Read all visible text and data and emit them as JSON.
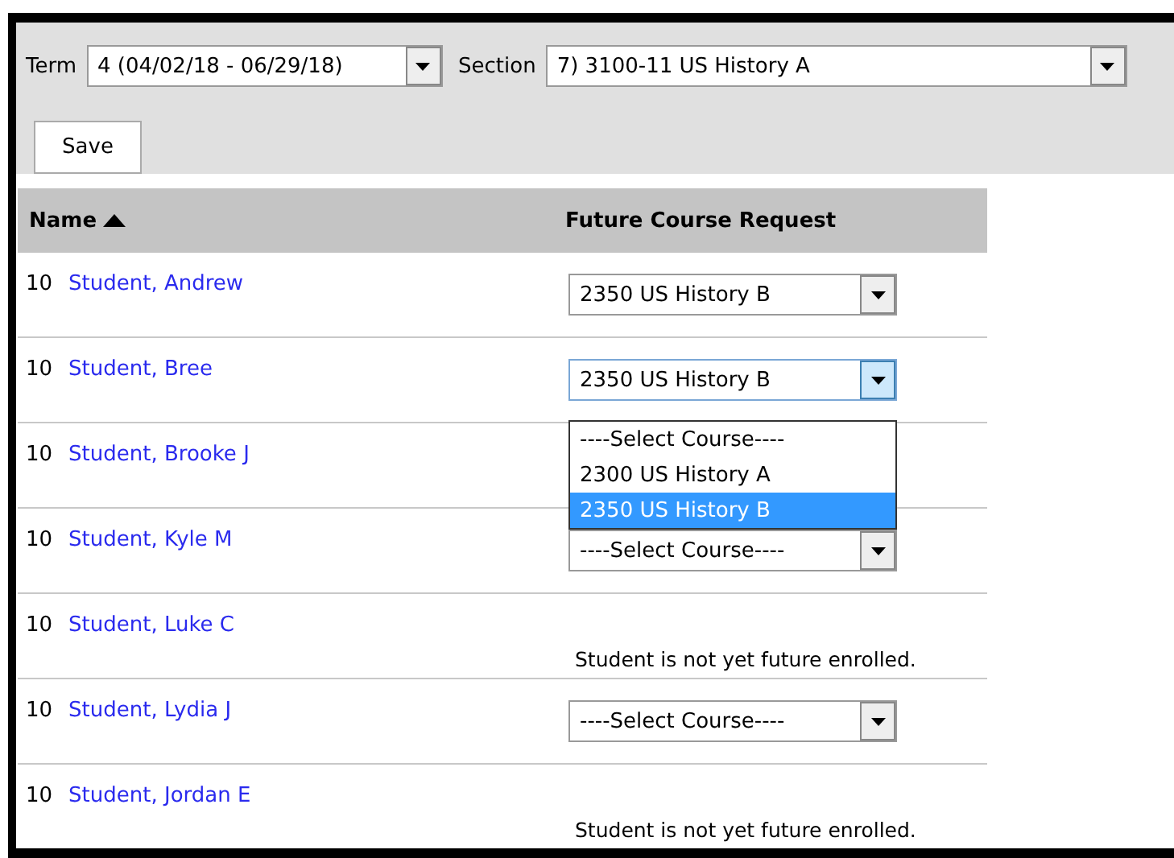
{
  "filters": {
    "term": {
      "label": "Term",
      "value": "4 (04/02/18 - 06/29/18)"
    },
    "section": {
      "label": "Section",
      "value": "7) 3100-11 US History A"
    }
  },
  "save_button": "Save",
  "table": {
    "columns": [
      {
        "label": "Name",
        "sorted": true
      },
      {
        "label": "Future Course Request",
        "sorted": false
      }
    ],
    "rows": [
      {
        "grade": "10",
        "name": "Student, Andrew",
        "request": {
          "kind": "select",
          "value": "2350 US History B",
          "expanded": false
        }
      },
      {
        "grade": "10",
        "name": "Student, Bree",
        "request": {
          "kind": "select",
          "value": "2350 US History B",
          "expanded": true,
          "options": [
            {
              "label": "----Select Course----",
              "selected": false
            },
            {
              "label": "2300 US History A",
              "selected": false
            },
            {
              "label": "2350 US History B",
              "selected": true
            }
          ]
        }
      },
      {
        "grade": "10",
        "name": "Student, Brooke J",
        "request": {
          "kind": "hidden"
        }
      },
      {
        "grade": "10",
        "name": "Student, Kyle M",
        "request": {
          "kind": "select",
          "value": "----Select Course----",
          "expanded": false
        }
      },
      {
        "grade": "10",
        "name": "Student, Luke C",
        "request": {
          "kind": "message",
          "text": "Student is not yet future enrolled."
        }
      },
      {
        "grade": "10",
        "name": "Student, Lydia J",
        "request": {
          "kind": "select",
          "value": "----Select Course----",
          "expanded": false
        }
      },
      {
        "grade": "10",
        "name": "Student, Jordan E",
        "request": {
          "kind": "message",
          "text": "Student is not yet future enrolled."
        }
      }
    ]
  }
}
